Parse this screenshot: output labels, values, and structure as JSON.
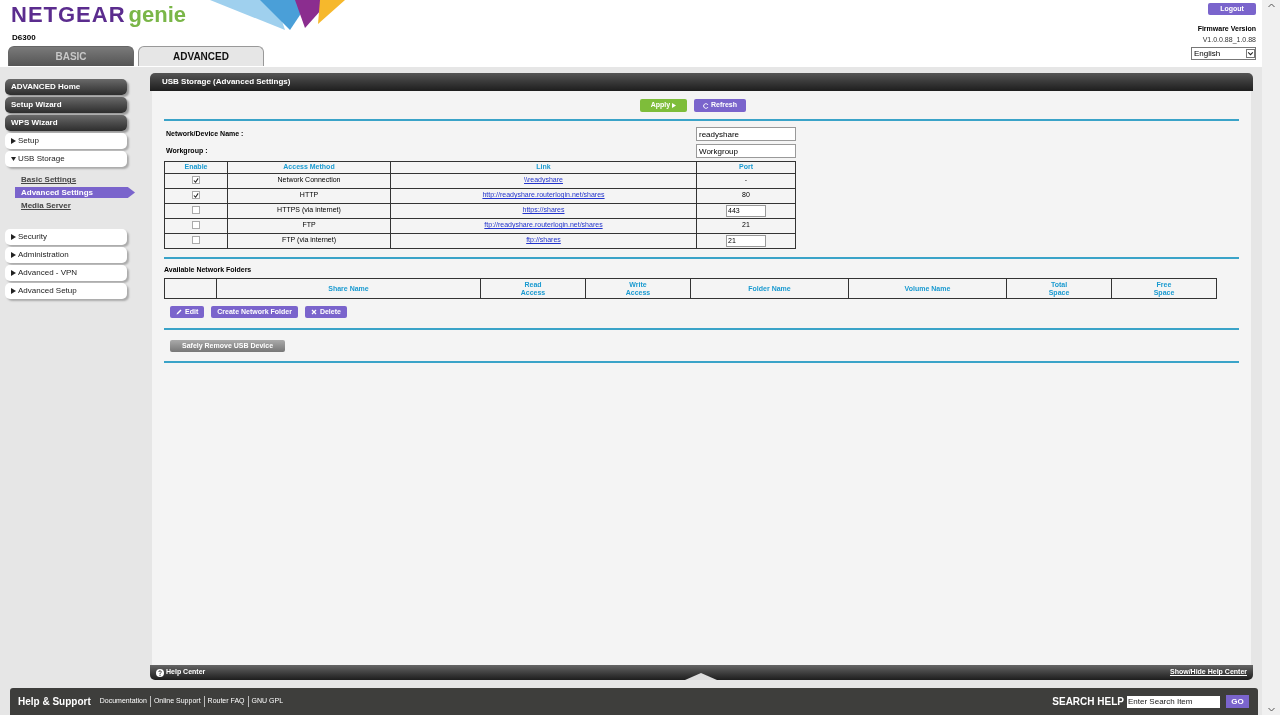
{
  "header": {
    "brand": "NETGEAR",
    "product": "genie",
    "model": "D6300",
    "logout": "Logout",
    "firmware_label": "Firmware Version",
    "firmware_version": "V1.0.0.88_1.0.88",
    "language": "English"
  },
  "tabs": [
    {
      "label": "BASIC",
      "selected": false
    },
    {
      "label": "ADVANCED",
      "selected": true
    }
  ],
  "sidebar": {
    "items": [
      {
        "label": "ADVANCED Home",
        "kind": "button"
      },
      {
        "label": "Setup Wizard",
        "kind": "button"
      },
      {
        "label": "WPS Wizard",
        "kind": "button"
      },
      {
        "label": "Setup",
        "kind": "menu",
        "expanded": false
      },
      {
        "label": "USB Storage",
        "kind": "menu",
        "expanded": true,
        "children": [
          {
            "label": "Basic Settings",
            "selected": false
          },
          {
            "label": "Advanced Settings",
            "selected": true
          },
          {
            "label": "Media Server",
            "selected": false
          }
        ]
      },
      {
        "label": "Security",
        "kind": "menu",
        "expanded": false
      },
      {
        "label": "Administration",
        "kind": "menu",
        "expanded": false
      },
      {
        "label": "Advanced - VPN",
        "kind": "menu",
        "expanded": false
      },
      {
        "label": "Advanced Setup",
        "kind": "menu",
        "expanded": false
      }
    ]
  },
  "panel": {
    "title": "USB Storage (Advanced Settings)",
    "apply": "Apply",
    "refresh": "Refresh",
    "fields": [
      {
        "label": "Network/Device Name :",
        "value": "readyshare"
      },
      {
        "label": "Workgroup :",
        "value": "Workgroup"
      }
    ],
    "access_table": {
      "columns": [
        "Enable",
        "Access Method",
        "Link",
        "Port"
      ],
      "rows": [
        {
          "enabled": true,
          "method": "Network Connection",
          "link": "\\\\readyshare",
          "port": "-",
          "kind": "text"
        },
        {
          "enabled": true,
          "method": "HTTP",
          "link": "http://readyshare.routerlogin.net/shares",
          "port": "80",
          "kind": "text"
        },
        {
          "enabled": false,
          "method": "HTTPS (via internet)",
          "link": "https://shares",
          "port": "443",
          "kind": "input"
        },
        {
          "enabled": false,
          "method": "FTP",
          "link": "ftp://readyshare.routerlogin.net/shares",
          "port": "21",
          "kind": "text"
        },
        {
          "enabled": false,
          "method": "FTP (via internet)",
          "link": "ftp://shares",
          "port": "21",
          "kind": "input"
        }
      ]
    },
    "folders_title": "Available Network Folders",
    "folders_table": {
      "columns": [
        "",
        "Share Name",
        "Read\nAccess",
        "Write\nAccess",
        "Folder Name",
        "Volume Name",
        "Total\nSpace",
        "Free\nSpace"
      ]
    },
    "folder_buttons": [
      "Edit",
      "Create Network Folder",
      "Delete"
    ],
    "safely_remove": "Safely Remove USB Device"
  },
  "help_bar": {
    "help_center": "Help Center",
    "toggle": "Show/Hide Help Center"
  },
  "footer": {
    "title": "Help & Support",
    "links": [
      "Documentation",
      "Online Support",
      "Router FAQ",
      "GNU GPL"
    ],
    "search_label": "SEARCH HELP",
    "search_placeholder": "Enter Search Item",
    "go": "GO"
  }
}
